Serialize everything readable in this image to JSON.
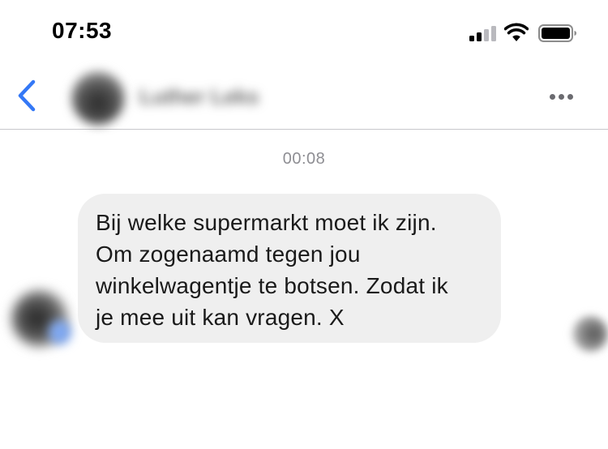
{
  "status_bar": {
    "time": "07:53",
    "icons": [
      "cellular-signal-icon",
      "wifi-icon",
      "battery-icon"
    ],
    "signal_bars_active": 2,
    "signal_bars_total": 4
  },
  "nav": {
    "back_icon": "chevron-left-icon",
    "contact_name": "Luther Leks",
    "more_icon": "ellipsis-icon"
  },
  "conversation": {
    "timestamp": "00:08",
    "message": {
      "lines": [
        "Bij welke supermarkt moet ik zijn.",
        "Om zogenaamd tegen jou",
        "winkelwagentje te botsen. Zodat ik",
        "je mee uit kan vragen. X"
      ]
    }
  },
  "colors": {
    "accent": "#3478f6",
    "bubble": "#efefef",
    "timestamp": "#8e8e93",
    "divider": "#c8c8cc"
  }
}
